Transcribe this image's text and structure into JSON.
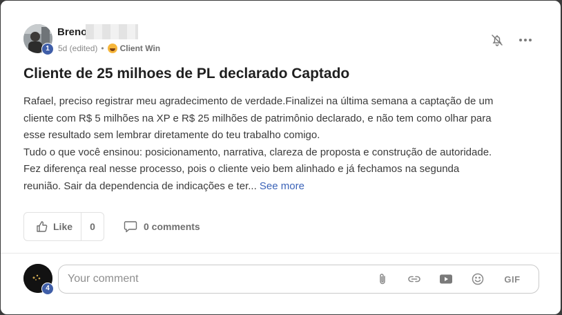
{
  "post": {
    "author_name": "Breno",
    "author_level": "1",
    "meta_time": "5d (edited)",
    "meta_separator": "•",
    "category": "Client Win",
    "title": "Cliente de 25 milhoes de PL declarado Captado",
    "body_lines": [
      "Rafael, preciso registrar meu agradecimento de verdade.Finalizei na última semana a captação de um",
      "cliente com R$ 5 milhões na XP e R$ 25 milhões de patrimônio declarado, e não tem como olhar para",
      "esse resultado sem lembrar diretamente do teu trabalho comigo.",
      "Tudo o que você ensinou: posicionamento, narrativa, clareza de proposta e construção de autoridade.",
      "Fez diferença real nesse processo, pois o cliente veio bem alinhado e já fechamos na segunda",
      "reunião. Sair da dependencia de indicações e ter..."
    ],
    "see_more": "See more"
  },
  "actions": {
    "like_label": "Like",
    "like_count": "0",
    "comments_label": "0 comments"
  },
  "composer": {
    "level": "4",
    "placeholder": "Your comment",
    "gif_label": "GIF"
  },
  "icons": {
    "bell": "bell-off-icon",
    "more": "more-horizontal-icon",
    "like": "thumbs-up-icon",
    "comment": "comment-bubble-icon",
    "attach": "paperclip-icon",
    "link": "link-icon",
    "video": "video-icon",
    "emoji": "emoji-icon"
  }
}
